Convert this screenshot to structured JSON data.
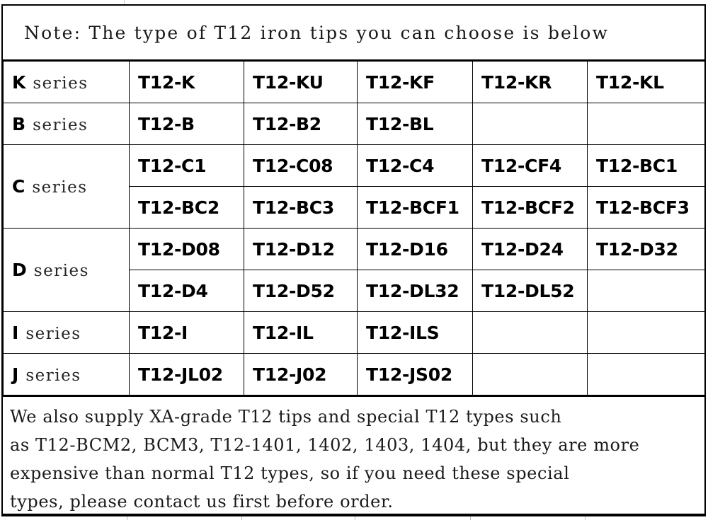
{
  "header": {
    "note": "Note: The type of T12 iron tips you can choose is below"
  },
  "table": {
    "series_word": "series",
    "rows": [
      {
        "series_letter": "K",
        "subrows": [
          [
            "T12-K",
            "T12-KU",
            "T12-KF",
            "T12-KR",
            "T12-KL"
          ]
        ]
      },
      {
        "series_letter": "B",
        "subrows": [
          [
            "T12-B",
            "T12-B2",
            "T12-BL",
            "",
            ""
          ]
        ]
      },
      {
        "series_letter": "C",
        "subrows": [
          [
            "T12-C1",
            "T12-C08",
            "T12-C4",
            "T12-CF4",
            "T12-BC1"
          ],
          [
            "T12-BC2",
            "T12-BC3",
            "T12-BCF1",
            "T12-BCF2",
            "T12-BCF3"
          ]
        ]
      },
      {
        "series_letter": "D",
        "subrows": [
          [
            "T12-D08",
            "T12-D12",
            "T12-D16",
            "T12-D24",
            "T12-D32"
          ],
          [
            "T12-D4",
            "T12-D52",
            "T12-DL32",
            "T12-DL52",
            ""
          ]
        ]
      },
      {
        "series_letter": "I",
        "subrows": [
          [
            "T12-I",
            "T12-IL",
            "T12-ILS",
            "",
            ""
          ]
        ]
      },
      {
        "series_letter": "J",
        "subrows": [
          [
            "T12-JL02",
            "T12-J02",
            "T12-JS02",
            "",
            ""
          ]
        ]
      }
    ]
  },
  "footer": {
    "lines": [
      "We also supply XA-grade T12 tips and special T12 types such",
      "as T12-BCM2, BCM3, T12-1401, 1402, 1403, 1404, but they are more",
      "expensive than normal T12 types, so if you need these special",
      "types, please contact us first before order."
    ]
  },
  "colors": {
    "border": "#000000",
    "text": "#000000",
    "background": "#ffffff"
  }
}
